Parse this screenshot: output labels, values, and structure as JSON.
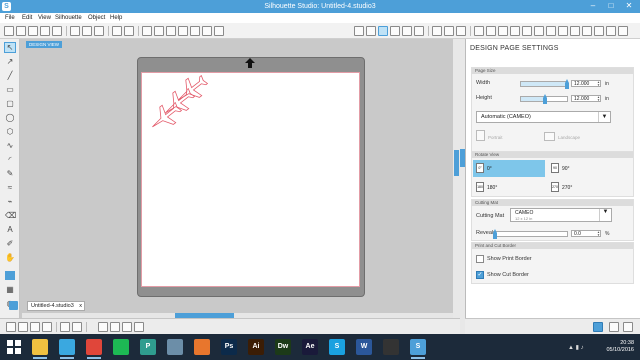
{
  "window": {
    "title": "Silhouette Studio: Untitled-4.studio3"
  },
  "menu": [
    "File",
    "Edit",
    "View",
    "Silhouette",
    "Object",
    "Help"
  ],
  "canvas": {
    "view_label": "DESIGN VIEW",
    "doc_tab": "Untitled-4.studio3",
    "close_glyph": "x"
  },
  "panel": {
    "title": "DESIGN PAGE SETTINGS",
    "page_size": {
      "header": "Page Size",
      "width_label": "Width",
      "width_value": "12.000",
      "height_label": "Height",
      "height_value": "12.000",
      "unit": "in",
      "preset": "Automatic (CAMEO)",
      "portrait": "Portrait",
      "landscape": "Landscape"
    },
    "rotate": {
      "header": "Rotate View",
      "options": [
        "0°",
        "90°",
        "180°",
        "270°"
      ],
      "selected": "0°"
    },
    "cutting_mat": {
      "header": "Cutting Mat",
      "label": "Cutting Mat",
      "value": "CAMEO",
      "sub": "12 x 12 in",
      "reveal_label": "Reveal",
      "reveal_value": "0.0",
      "reveal_unit": "%"
    },
    "borders": {
      "header": "Print and Cut Border",
      "print_border": "Show Print Border",
      "print_checked": false,
      "cut_border": "Show Cut Border",
      "cut_checked": true
    }
  },
  "taskbar": {
    "time": "20:38",
    "date": "05/10/2016",
    "apps": [
      {
        "name": "file-explorer",
        "label": "",
        "color": "#f0c040"
      },
      {
        "name": "media",
        "label": "",
        "color": "#3aa8e0"
      },
      {
        "name": "chrome",
        "label": "",
        "color": "#e0463a"
      },
      {
        "name": "spotify",
        "label": "",
        "color": "#1db954"
      },
      {
        "name": "photo-app",
        "label": "P",
        "color": "#2f9d8f"
      },
      {
        "name": "photo-app-2",
        "label": "",
        "color": "#6c8ea8"
      },
      {
        "name": "firefox",
        "label": "",
        "color": "#e8762d"
      },
      {
        "name": "photoshop",
        "label": "Ps",
        "color": "#0c2a4a"
      },
      {
        "name": "illustrator",
        "label": "Ai",
        "color": "#3b1d05"
      },
      {
        "name": "dreamweaver",
        "label": "Dw",
        "color": "#1c3a18"
      },
      {
        "name": "after-effects",
        "label": "Ae",
        "color": "#1a1a3a"
      },
      {
        "name": "skype",
        "label": "S",
        "color": "#1aa1e0"
      },
      {
        "name": "word",
        "label": "W",
        "color": "#2b579a"
      },
      {
        "name": "sketchbook",
        "label": "",
        "color": "#333333"
      },
      {
        "name": "silhouette",
        "label": "S",
        "color": "#4d9fd8"
      }
    ]
  }
}
